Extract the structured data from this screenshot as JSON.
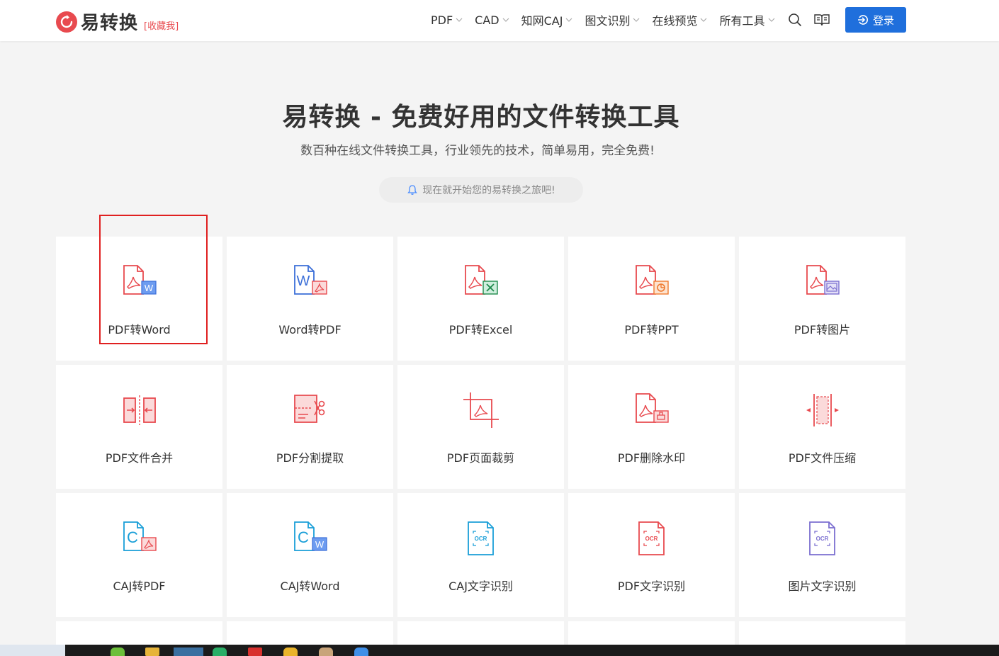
{
  "header": {
    "logo_text": "易转换",
    "favorite_label": "[收藏我]",
    "nav": [
      "PDF",
      "CAD",
      "知网CAJ",
      "图文识别",
      "在线预览",
      "所有工具"
    ],
    "login_label": "登录"
  },
  "hero": {
    "title": "易转换 - 免费好用的文件转换工具",
    "subtitle": "数百种在线文件转换工具，行业领先的技术，简单易用，完全免费!",
    "cta": "现在就开始您的易转换之旅吧!"
  },
  "tools": [
    {
      "label": "PDF转Word",
      "icon": "pdf-to-word-icon"
    },
    {
      "label": "Word转PDF",
      "icon": "word-to-pdf-icon"
    },
    {
      "label": "PDF转Excel",
      "icon": "pdf-to-excel-icon"
    },
    {
      "label": "PDF转PPT",
      "icon": "pdf-to-ppt-icon"
    },
    {
      "label": "PDF转图片",
      "icon": "pdf-to-image-icon"
    },
    {
      "label": "PDF文件合并",
      "icon": "pdf-merge-icon"
    },
    {
      "label": "PDF分割提取",
      "icon": "pdf-split-icon"
    },
    {
      "label": "PDF页面裁剪",
      "icon": "pdf-crop-icon"
    },
    {
      "label": "PDF删除水印",
      "icon": "pdf-remove-watermark-icon"
    },
    {
      "label": "PDF文件压缩",
      "icon": "pdf-compress-icon"
    },
    {
      "label": "CAJ转PDF",
      "icon": "caj-to-pdf-icon"
    },
    {
      "label": "CAJ转Word",
      "icon": "caj-to-word-icon"
    },
    {
      "label": "CAJ文字识别",
      "icon": "caj-ocr-icon"
    },
    {
      "label": "PDF文字识别",
      "icon": "pdf-ocr-icon"
    },
    {
      "label": "图片文字识别",
      "icon": "image-ocr-icon"
    }
  ],
  "colors": {
    "brand_red": "#e84a4f",
    "login_blue": "#1f6fdc",
    "highlight_red": "#e02020"
  }
}
